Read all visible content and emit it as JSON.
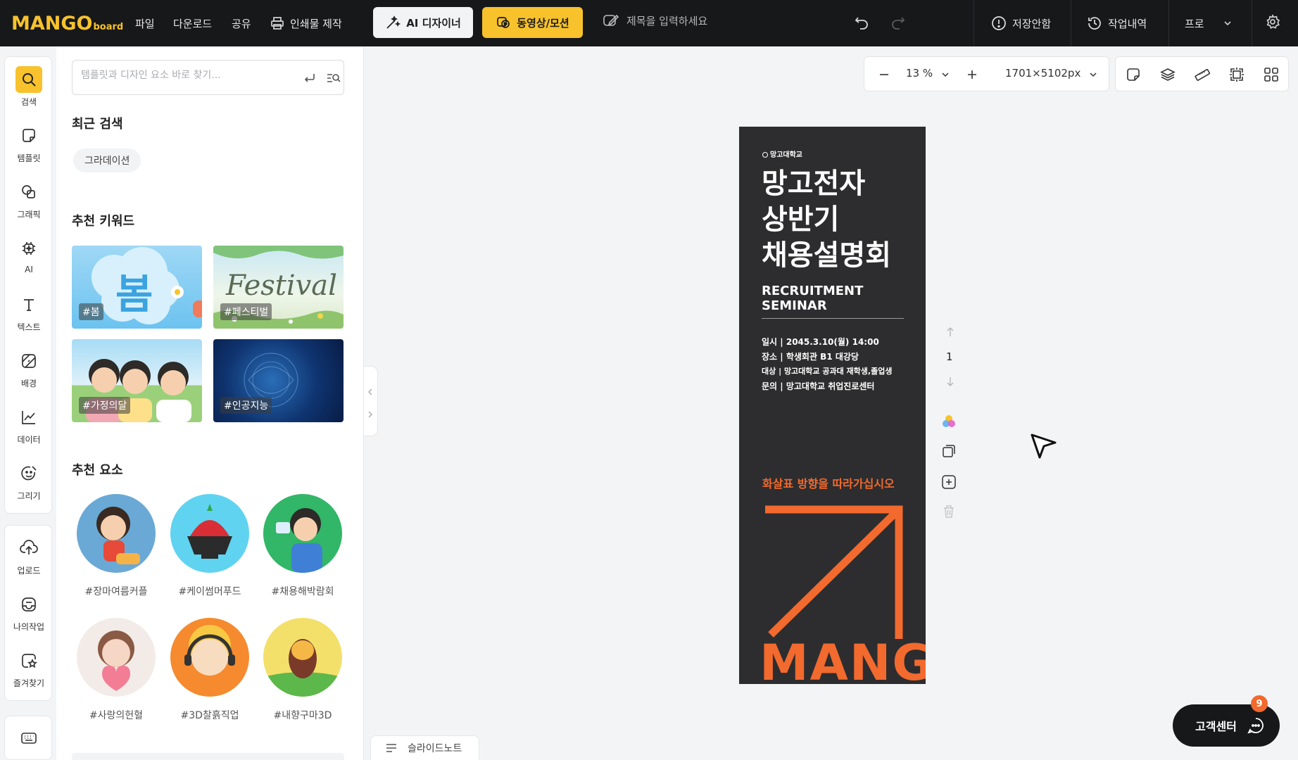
{
  "app": {
    "logo_main": "MANGO",
    "logo_sub": "board"
  },
  "topbar": {
    "menu": [
      "파일",
      "다운로드",
      "공유"
    ],
    "print_label": "인쇄물 제작",
    "ai_designer_label": "AI 디자이너",
    "video_label": "동영상/모션",
    "title_placeholder": "제목을 입력하세요",
    "save_status": "저장안함",
    "history_label": "작업내역",
    "plan_label": "프로"
  },
  "leftnav": {
    "items": [
      {
        "label": "검색",
        "icon": "search-icon"
      },
      {
        "label": "템플릿",
        "icon": "template-icon"
      },
      {
        "label": "그래픽",
        "icon": "graphic-icon"
      },
      {
        "label": "AI",
        "icon": "ai-chip-icon"
      },
      {
        "label": "텍스트",
        "icon": "text-icon"
      },
      {
        "label": "배경",
        "icon": "background-icon"
      },
      {
        "label": "데이터",
        "icon": "chart-icon"
      },
      {
        "label": "그리기",
        "icon": "draw-icon"
      },
      {
        "label": "업로드",
        "icon": "upload-icon"
      },
      {
        "label": "나의작업",
        "icon": "my-work-icon"
      },
      {
        "label": "즐겨찾기",
        "icon": "favorite-icon"
      }
    ]
  },
  "panel": {
    "search_placeholder": "템플릿과 디자인 요소 바로 찾기...",
    "recent_title": "최근 검색",
    "recent_items": [
      "그라데이션"
    ],
    "keywords_title": "추천 키워드",
    "keywords": [
      {
        "tag": "#봄",
        "art_text": "봄"
      },
      {
        "tag": "#페스티벌",
        "art_text": "Festival"
      },
      {
        "tag": "#가정의달"
      },
      {
        "tag": "#인공지능"
      }
    ],
    "elements_title": "추천 요소",
    "elements": [
      {
        "caption": "#장마여름커플"
      },
      {
        "caption": "#케이썸머푸드"
      },
      {
        "caption": "#채용해박람회"
      },
      {
        "caption": "#사랑의헌혈"
      },
      {
        "caption": "#3D찰흙직업"
      },
      {
        "caption": "#내향구마3D"
      }
    ]
  },
  "canvas": {
    "zoom": "13 %",
    "size": "1701×5102px",
    "page_number": "1"
  },
  "poster": {
    "org": "망고대학교",
    "title_lines": [
      "망고전자",
      "상반기",
      "채용설명회"
    ],
    "subtitle": "RECRUITMENT SEMINAR",
    "info": [
      {
        "key": "일시",
        "value": "2045.3.10(월) 14:00"
      },
      {
        "key": "장소",
        "value": "학생회관 B1 대강당"
      },
      {
        "key": "대상",
        "value": "망고대학교 공과대 재학생,졸업생"
      },
      {
        "key": "문의",
        "value": "망고대학교 취업진로센터"
      }
    ],
    "call_text": "화살표 방향을 따라가십시오",
    "brand": "MANGO"
  },
  "footer": {
    "slide_note": "슬라이드노트",
    "help_label": "고객센터",
    "help_badge": "9"
  },
  "colors": {
    "accent": "#f7c22c",
    "topbar_bg": "#17181a",
    "poster_bg": "#2d2d2f",
    "poster_orange": "#f26a2e"
  }
}
